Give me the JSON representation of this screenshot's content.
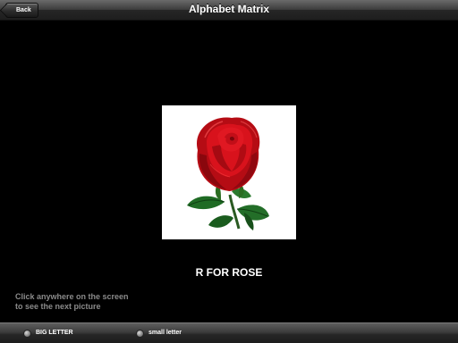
{
  "nav": {
    "back_label": "Back",
    "title": "Alphabet Matrix"
  },
  "picture": {
    "subject": "red rose",
    "caption": "R FOR ROSE"
  },
  "hint": {
    "line1": "Click anywhere on the screen",
    "line2": "to see the next picture"
  },
  "bottom_bar": {
    "options": [
      {
        "label": "BIG LETTER"
      },
      {
        "label": "small letter"
      }
    ]
  },
  "colors": {
    "background": "#000000",
    "hint_text": "#8a8a8a",
    "rose_red": "#d0101a",
    "leaf_green": "#1f6b24"
  }
}
